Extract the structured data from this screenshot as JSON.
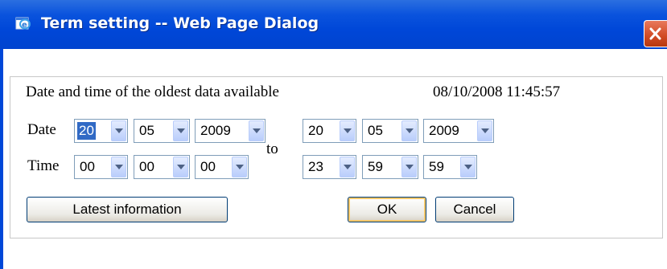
{
  "window": {
    "title": "Term setting -- Web Page Dialog",
    "accent_color": "#0047d8",
    "icons": {
      "app": "ie-page-icon",
      "close": "close-icon"
    }
  },
  "dialog": {
    "oldest_label": "Date and time of the oldest data available",
    "oldest_value": "08/10/2008 11:45:57",
    "date_label": "Date",
    "time_label": "Time",
    "to_label": "to",
    "from": {
      "date": {
        "day": "20",
        "month": "05",
        "year": "2009"
      },
      "time": {
        "hour": "00",
        "minute": "00",
        "second": "00"
      }
    },
    "to": {
      "date": {
        "day": "20",
        "month": "05",
        "year": "2009"
      },
      "time": {
        "hour": "23",
        "minute": "59",
        "second": "59"
      }
    },
    "buttons": {
      "latest": "Latest information",
      "ok": "OK",
      "cancel": "Cancel"
    }
  }
}
